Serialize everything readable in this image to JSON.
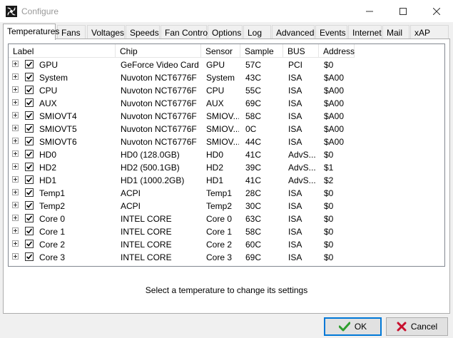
{
  "window": {
    "title": "Configure"
  },
  "tabs": [
    {
      "label": "Temperatures",
      "active": true
    },
    {
      "label": "Fans"
    },
    {
      "label": "Voltages"
    },
    {
      "label": "Speeds"
    },
    {
      "label": "Fan Control"
    },
    {
      "label": "Options"
    },
    {
      "label": "Log"
    },
    {
      "label": "Advanced"
    },
    {
      "label": "Events"
    },
    {
      "label": "Internet"
    },
    {
      "label": "Mail"
    },
    {
      "label": "xAP"
    }
  ],
  "table": {
    "columns": [
      "Label",
      "Chip",
      "Sensor",
      "Sample",
      "BUS",
      "Address"
    ],
    "rows": [
      {
        "label": "GPU",
        "chip": "GeForce Video Card",
        "sensor": "GPU",
        "sample": "57C",
        "bus": "PCI",
        "address": "$0"
      },
      {
        "label": "System",
        "chip": "Nuvoton NCT6776F",
        "sensor": "System",
        "sample": "43C",
        "bus": "ISA",
        "address": "$A00"
      },
      {
        "label": "CPU",
        "chip": "Nuvoton NCT6776F",
        "sensor": "CPU",
        "sample": "55C",
        "bus": "ISA",
        "address": "$A00"
      },
      {
        "label": "AUX",
        "chip": "Nuvoton NCT6776F",
        "sensor": "AUX",
        "sample": "69C",
        "bus": "ISA",
        "address": "$A00"
      },
      {
        "label": "SMIOVT4",
        "chip": "Nuvoton NCT6776F",
        "sensor": "SMIOV...",
        "sample": "58C",
        "bus": "ISA",
        "address": "$A00"
      },
      {
        "label": "SMIOVT5",
        "chip": "Nuvoton NCT6776F",
        "sensor": "SMIOV...",
        "sample": "0C",
        "bus": "ISA",
        "address": "$A00"
      },
      {
        "label": "SMIOVT6",
        "chip": "Nuvoton NCT6776F",
        "sensor": "SMIOV...",
        "sample": "44C",
        "bus": "ISA",
        "address": "$A00"
      },
      {
        "label": "HD0",
        "chip": "HD0 (128.0GB)",
        "sensor": "HD0",
        "sample": "41C",
        "bus": "AdvS...",
        "address": "$0"
      },
      {
        "label": "HD2",
        "chip": "HD2 (500.1GB)",
        "sensor": "HD2",
        "sample": "39C",
        "bus": "AdvS...",
        "address": "$1"
      },
      {
        "label": "HD1",
        "chip": "HD1 (1000.2GB)",
        "sensor": "HD1",
        "sample": "41C",
        "bus": "AdvS...",
        "address": "$2"
      },
      {
        "label": "Temp1",
        "chip": "ACPI",
        "sensor": "Temp1",
        "sample": "28C",
        "bus": "ISA",
        "address": "$0"
      },
      {
        "label": "Temp2",
        "chip": "ACPI",
        "sensor": "Temp2",
        "sample": "30C",
        "bus": "ISA",
        "address": "$0"
      },
      {
        "label": "Core 0",
        "chip": "INTEL CORE",
        "sensor": "Core 0",
        "sample": "63C",
        "bus": "ISA",
        "address": "$0"
      },
      {
        "label": "Core 1",
        "chip": "INTEL CORE",
        "sensor": "Core 1",
        "sample": "58C",
        "bus": "ISA",
        "address": "$0"
      },
      {
        "label": "Core 2",
        "chip": "INTEL CORE",
        "sensor": "Core 2",
        "sample": "60C",
        "bus": "ISA",
        "address": "$0"
      },
      {
        "label": "Core 3",
        "chip": "INTEL CORE",
        "sensor": "Core 3",
        "sample": "69C",
        "bus": "ISA",
        "address": "$0"
      }
    ]
  },
  "hint": "Select a temperature to change its settings",
  "buttons": {
    "ok": "OK",
    "cancel": "Cancel"
  },
  "icons": {
    "app": "speedfan-icon",
    "ok": "checkmark-icon",
    "cancel": "cross-icon"
  },
  "colors": {
    "ok_check": "#2e9e2e",
    "cancel_x": "#c8102e",
    "focus": "#0078d7"
  }
}
